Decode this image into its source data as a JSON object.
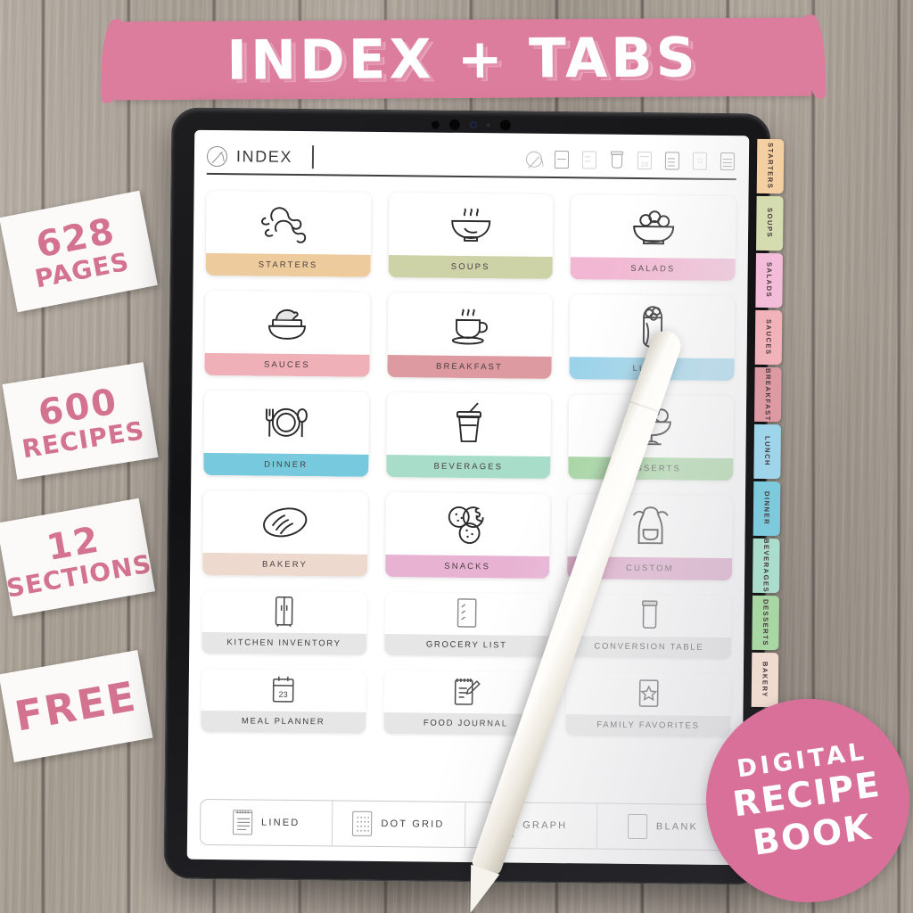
{
  "banner": {
    "title": "INDEX + TABS"
  },
  "badges": [
    {
      "name": "pages",
      "number": "628",
      "label": "PAGES"
    },
    {
      "name": "recipes",
      "number": "600",
      "label": "RECIPES"
    },
    {
      "name": "sections",
      "number": "12",
      "label": "SECTIONS"
    },
    {
      "name": "free",
      "number": "FREE",
      "label": ""
    }
  ],
  "round_badge": {
    "line1": "DIGITAL",
    "line2": "RECIPE",
    "line3": "BOOK",
    "color": "#d9709a"
  },
  "toolbar": {
    "title": "INDEX",
    "left_icon": "compass-icon",
    "icons": [
      {
        "name": "compass-icon",
        "label": "Index"
      },
      {
        "name": "fridge-icon",
        "label": "Kitchen Inventory"
      },
      {
        "name": "list-icon",
        "label": "Grocery List"
      },
      {
        "name": "jar-icon",
        "label": "Conversion Table"
      },
      {
        "name": "calendar-icon",
        "label": "Meal Planner",
        "text": "23"
      },
      {
        "name": "journal-icon",
        "label": "Food Journal"
      },
      {
        "name": "star-page-icon",
        "label": "Family Favorites"
      },
      {
        "name": "notepad-icon",
        "label": "Notes"
      }
    ]
  },
  "grid": {
    "categories": [
      {
        "label": "STARTERS",
        "color": "#edcb9c",
        "icon": "drumsticks-icon"
      },
      {
        "label": "SOUPS",
        "color": "#ced3a7",
        "icon": "soup-bowl-icon"
      },
      {
        "label": "SALADS",
        "color": "#f2b8d3",
        "icon": "salad-bowl-icon"
      },
      {
        "label": "SAUCES",
        "color": "#efb0b8",
        "icon": "sauce-bowl-icon"
      },
      {
        "label": "BREAKFAST",
        "color": "#dd9aa1",
        "icon": "coffee-cup-icon"
      },
      {
        "label": "LUNCH",
        "color": "#9bd3ea",
        "icon": "wrap-icon"
      },
      {
        "label": "DINNER",
        "color": "#77c9dd",
        "icon": "plate-cutlery-icon"
      },
      {
        "label": "BEVERAGES",
        "color": "#a8ddca",
        "icon": "drink-cup-icon"
      },
      {
        "label": "DESSERTS",
        "color": "#a4d5a0",
        "icon": "ice-cream-bowl-icon"
      },
      {
        "label": "BAKERY",
        "color": "#eed9ce",
        "icon": "bread-loaf-icon"
      },
      {
        "label": "SNACKS",
        "color": "#e8b2d3",
        "icon": "cookies-icon"
      },
      {
        "label": "CUSTOM",
        "color": "#dda3c6",
        "icon": "apron-icon"
      }
    ],
    "utilities": [
      {
        "label": "KITCHEN INVENTORY",
        "icon": "fridge-icon"
      },
      {
        "label": "GROCERY LIST",
        "icon": "list-icon"
      },
      {
        "label": "CONVERSION TABLE",
        "icon": "jar-icon"
      },
      {
        "label": "MEAL PLANNER",
        "icon": "calendar-icon",
        "text": "23"
      },
      {
        "label": "FOOD JOURNAL",
        "icon": "journal-icon"
      },
      {
        "label": "FAMILY FAVORITES",
        "icon": "star-page-icon"
      }
    ]
  },
  "paper_bar": {
    "options": [
      {
        "label": "LINED",
        "icon": "lined-paper-icon"
      },
      {
        "label": "DOT GRID",
        "icon": "dot-grid-paper-icon"
      },
      {
        "label": "GRAPH",
        "icon": "graph-paper-icon"
      },
      {
        "label": "BLANK",
        "icon": "blank-paper-icon"
      }
    ]
  },
  "side_tabs": [
    {
      "label": "STARTERS",
      "color": "#f3cfa1"
    },
    {
      "label": "SOUPS",
      "color": "#d5dcb0"
    },
    {
      "label": "SALADS",
      "color": "#f3bcd8"
    },
    {
      "label": "SAUCES",
      "color": "#f1b2ba"
    },
    {
      "label": "BREAKFAST",
      "color": "#de9aa3"
    },
    {
      "label": "LUNCH",
      "color": "#9ed5ea"
    },
    {
      "label": "DINNER",
      "color": "#7ecadd"
    },
    {
      "label": "BEVERAGES",
      "color": "#aaddcb"
    },
    {
      "label": "DESSERTS",
      "color": "#a8d7a4"
    },
    {
      "label": "BAKERY",
      "color": "#f0dbd0"
    }
  ]
}
